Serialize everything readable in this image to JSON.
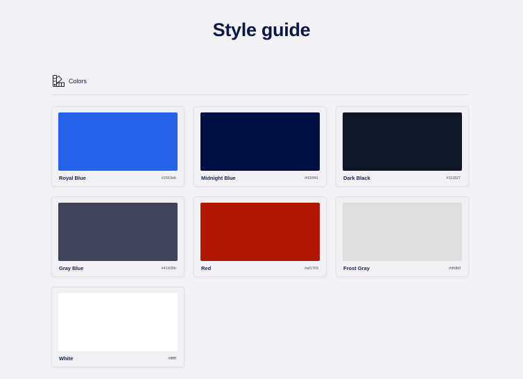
{
  "page": {
    "title": "Style guide"
  },
  "section": {
    "label": "Colors",
    "icon": "color-palette-icon"
  },
  "colors": [
    {
      "name": "Royal Blue",
      "hex": "#2563eb",
      "swatch": "#2563eb"
    },
    {
      "name": "Midnight Blue",
      "hex": "#000f41",
      "swatch": "#000f41"
    },
    {
      "name": "Dark Black",
      "hex": "#111827",
      "swatch": "#111827"
    },
    {
      "name": "Gray Blue",
      "hex": "#41435b",
      "swatch": "#41435b"
    },
    {
      "name": "Red",
      "hex": "#af1703",
      "swatch": "#af1703"
    },
    {
      "name": "Frost Gray",
      "hex": "#dfdfdf",
      "swatch": "#dfdfdf"
    },
    {
      "name": "White",
      "hex": "#ffffff",
      "swatch": "#ffffff"
    }
  ]
}
